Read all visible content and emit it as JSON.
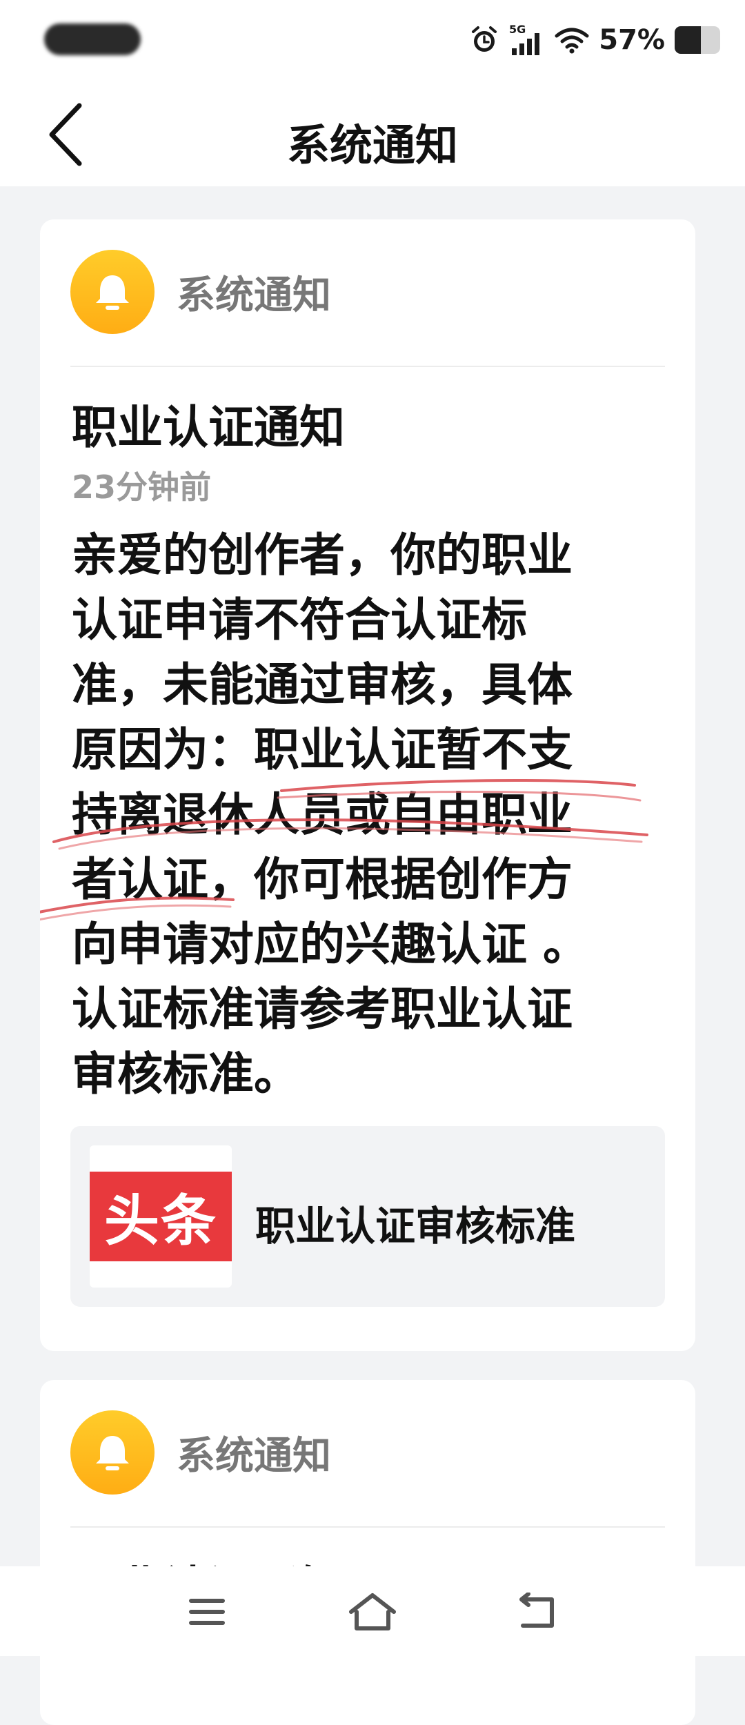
{
  "status_bar": {
    "network": "5G",
    "battery_text": "57%",
    "battery_level": 0.57,
    "icons": [
      "alarm-icon",
      "signal-5g-icon",
      "wifi-icon",
      "battery-icon"
    ]
  },
  "header": {
    "title": "系统通知",
    "back_icon": "chevron-left-icon"
  },
  "notifications": [
    {
      "source": "系统通知",
      "icon": "bell-icon",
      "title": "职业认证通知",
      "time": "23分钟前",
      "body_lines": [
        "亲爱的创作者，你的职业",
        "认证申请不符合认证标",
        "准，未能通过审核，具体",
        "原因为：职业认证暂不支",
        "持离退休人员或自由职业",
        "者认证，你可根据创作方",
        "向申请对应的兴趣认证 。",
        "认证标准请参考职业认证",
        "审核标准。"
      ],
      "link": {
        "logo_text": "头条",
        "label": "职业认证审核标准"
      }
    },
    {
      "source": "系统通知",
      "icon": "bell-icon",
      "title": "职业认证通知"
    }
  ],
  "nav": {
    "icons": [
      "menu-icon",
      "home-icon",
      "back-icon"
    ]
  },
  "colors": {
    "bell": "#ffb81c",
    "logo_red": "#e8393d",
    "scribble": "#d9464b"
  }
}
